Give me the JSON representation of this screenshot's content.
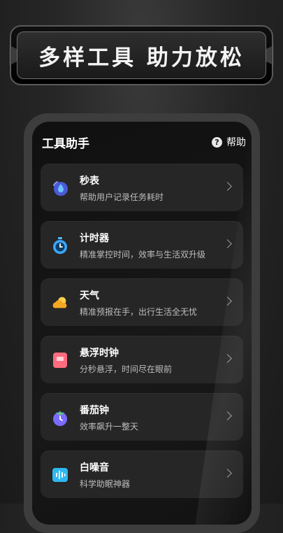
{
  "banner": {
    "title": "多样工具 助力放松"
  },
  "header": {
    "title": "工具助手",
    "help_label": "帮助"
  },
  "tools": [
    {
      "title": "秒表",
      "desc": "帮助用户记录任务耗时",
      "icon": "stopwatch-drop-icon"
    },
    {
      "title": "计时器",
      "desc": "精准掌控时间，效率与生活双升级",
      "icon": "timer-icon"
    },
    {
      "title": "天气",
      "desc": "精准预报在手，出行生活全无忧",
      "icon": "weather-cloud-sun-icon"
    },
    {
      "title": "悬浮时钟",
      "desc": "分秒悬浮，时间尽在眼前",
      "icon": "floating-clock-icon"
    },
    {
      "title": "番茄钟",
      "desc": "效率飙升一整天",
      "icon": "tomato-clock-icon"
    },
    {
      "title": "白噪音",
      "desc": "科学助眠神器",
      "icon": "white-noise-icon"
    }
  ],
  "colors": {
    "accent_blue": "#3aa8ff",
    "accent_orange": "#f5a623",
    "accent_pink": "#ff6b7f",
    "accent_purple": "#7b6cff"
  }
}
